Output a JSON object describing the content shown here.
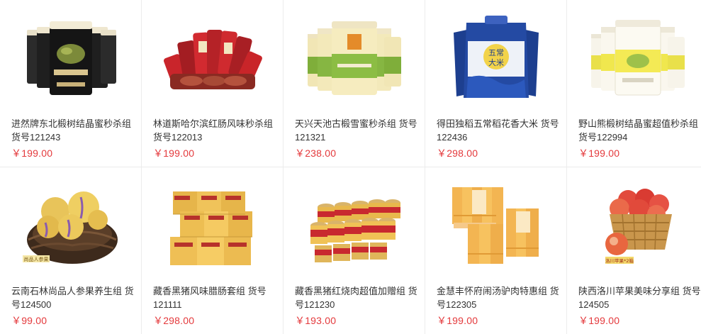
{
  "products": [
    {
      "name_line1": "进然牌东北椴树结晶蜜秒杀组",
      "name_line2": "货号121243",
      "price": "￥199.00",
      "image": "椴树结晶蜜"
    },
    {
      "name_line1": "林道斯哈尔滨红肠风味秒杀组",
      "name_line2": "货号122013",
      "price": "￥199.00",
      "image": "红肠"
    },
    {
      "name_line1": "天兴天池古椴雪蜜秒杀组 货号",
      "name_line2": "121321",
      "price": "￥238.00",
      "image": "椴雪蜜"
    },
    {
      "name_line1": "得田独稻五常稻花香大米 货号",
      "name_line2": "122436",
      "price": "￥298.00",
      "image": "五常大米"
    },
    {
      "name_line1": "野山熊椴树结晶蜜超值秒杀组",
      "name_line2": "货号122994",
      "price": "￥199.00",
      "image": "椴树结晶蜜"
    },
    {
      "name_line1": "云南石林尚品人参果养生组 货",
      "name_line2": "号124500",
      "price": "￥99.00",
      "image": "人参果",
      "img_label": "尚品人参果"
    },
    {
      "name_line1": "藏香黑猪风味腊肠套组 货号",
      "name_line2": "121111",
      "price": "￥298.00",
      "image": "腊肠"
    },
    {
      "name_line1": "藏香黑猪红烧肉超值加赠组 货",
      "name_line2": "号121230",
      "price": "￥193.00",
      "image": "红烧肉罐头"
    },
    {
      "name_line1": "金慧丰怀府闹汤驴肉特惠组 货",
      "name_line2": "号122305",
      "price": "￥199.00",
      "image": "驴肉"
    },
    {
      "name_line1": "陕西洛川苹果美味分享组 货号",
      "name_line2": "124505",
      "price": "￥199.00",
      "image": "苹果",
      "img_label": "洛川苹果*2箱"
    }
  ],
  "colors": {
    "price": "#e4393c",
    "text": "#333333",
    "border": "#ececec"
  }
}
